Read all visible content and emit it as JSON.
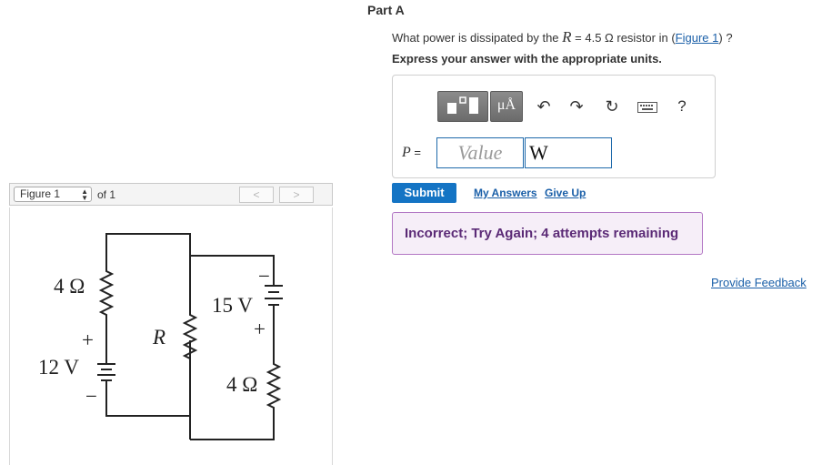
{
  "figure_panel": {
    "select_value": "Figure 1",
    "of_text": "of 1",
    "prev_glyph": "<",
    "next_glyph": ">",
    "circuit_labels": {
      "r_left_top": "4 Ω",
      "battery_left": "12 V",
      "battery_left_plus": "+",
      "battery_left_minus": "−",
      "r_middle": "R",
      "battery_right": "15 V",
      "battery_right_plus": "+",
      "battery_right_minus": "−",
      "r_right_bottom": "4 Ω"
    }
  },
  "part": {
    "title": "Part A",
    "question_prefix": "What power is dissipated by the ",
    "question_var": "R",
    "question_eq": " = 4.5 Ω resistor in (",
    "question_link": "Figure 1",
    "question_suffix": ") ?",
    "instruction": "Express your answer with the appropriate units."
  },
  "toolbar": {
    "templates_icon": "templates-icon",
    "units_label": "μÅ",
    "undo_glyph": "↶",
    "redo_glyph": "↷",
    "reset_glyph": "↻",
    "keyboard_icon": "keyboard-icon",
    "help_glyph": "?"
  },
  "answer": {
    "label_var": "P",
    "label_eq": " =",
    "value_placeholder": "Value",
    "unit_value": "W"
  },
  "actions": {
    "submit": "Submit",
    "my_answers": "My Answers",
    "give_up": "Give Up"
  },
  "feedback": {
    "message": "Incorrect; Try Again; 4 attempts remaining",
    "provide_feedback": "Provide Feedback"
  },
  "colors": {
    "submit_bg": "#1474c4",
    "link": "#1a5fa8",
    "feedback_bg": "#f6eef8",
    "feedback_border": "#b276c4",
    "feedback_text": "#5b2a76"
  }
}
